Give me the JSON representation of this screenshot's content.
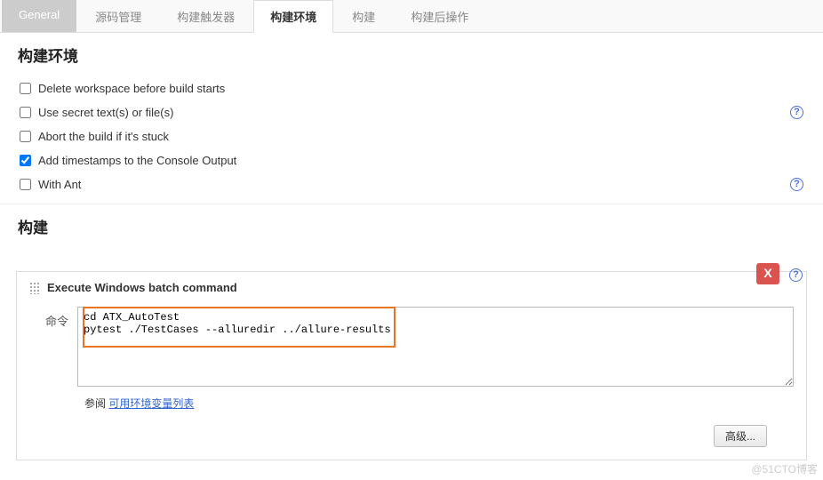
{
  "tabs": {
    "general": "General",
    "scm": "源码管理",
    "triggers": "构建触发器",
    "env": "构建环境",
    "build": "构建",
    "post": "构建后操作"
  },
  "env_section": {
    "title": "构建环境",
    "opts": {
      "delete_ws": "Delete workspace before build starts",
      "secrets": "Use secret text(s) or file(s)",
      "abort": "Abort the build if it's stuck",
      "timestamps": "Add timestamps to the Console Output",
      "with_ant": "With Ant"
    }
  },
  "build_section": {
    "title": "构建",
    "step_title": "Execute Windows batch command",
    "cmd_label": "命令",
    "cmd_value": "cd ATX_AutoTest\npytest ./TestCases --alluredir ../allure-results",
    "ref_prefix": "参阅 ",
    "ref_link": "可用环境变量列表",
    "advanced": "高级...",
    "delete_x": "X"
  },
  "watermark": "@51CTO博客"
}
